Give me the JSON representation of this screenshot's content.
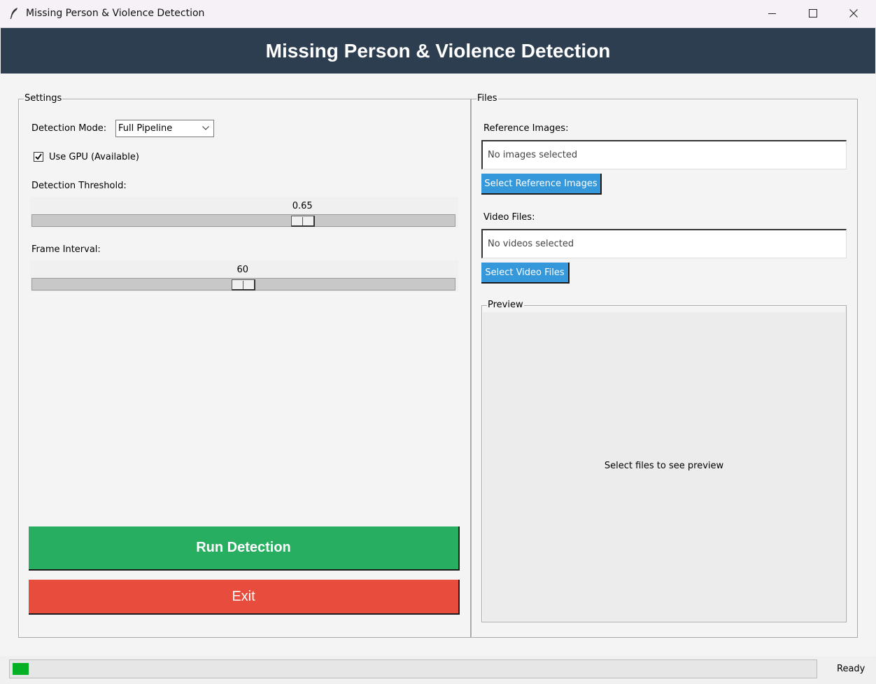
{
  "window": {
    "title": "Missing Person & Violence Detection",
    "icon": "feather-icon",
    "controls": [
      "minimize-icon",
      "maximize-icon",
      "close-icon"
    ]
  },
  "header": {
    "title": "Missing Person & Violence Detection",
    "background": "#2c3e50"
  },
  "settings": {
    "frame_title": "Settings",
    "detection_mode_label": "Detection Mode:",
    "detection_mode_value": "Full Pipeline",
    "gpu_label": "Use GPU (Available)",
    "gpu_checked": true,
    "threshold_label": "Detection Threshold:",
    "threshold_value": "0.65",
    "threshold_fraction": 0.65,
    "interval_label": "Frame Interval:",
    "interval_value": "60",
    "interval_fraction": 0.5
  },
  "actions": {
    "run_label": "Run Detection",
    "run_color": "#27ae60",
    "exit_label": "Exit",
    "exit_color": "#e74c3c"
  },
  "files": {
    "frame_title": "Files",
    "ref_label": "Reference Images:",
    "ref_value": "No images selected",
    "ref_button": "Select Reference Images",
    "video_label": "Video Files:",
    "video_value": "No videos selected",
    "video_button": "Select Video Files",
    "button_color": "#3498db",
    "preview_title": "Preview",
    "preview_text": "Select files to see preview"
  },
  "status": {
    "text": "Ready",
    "progress_fraction": 0.02,
    "progress_color": "#06b025"
  }
}
